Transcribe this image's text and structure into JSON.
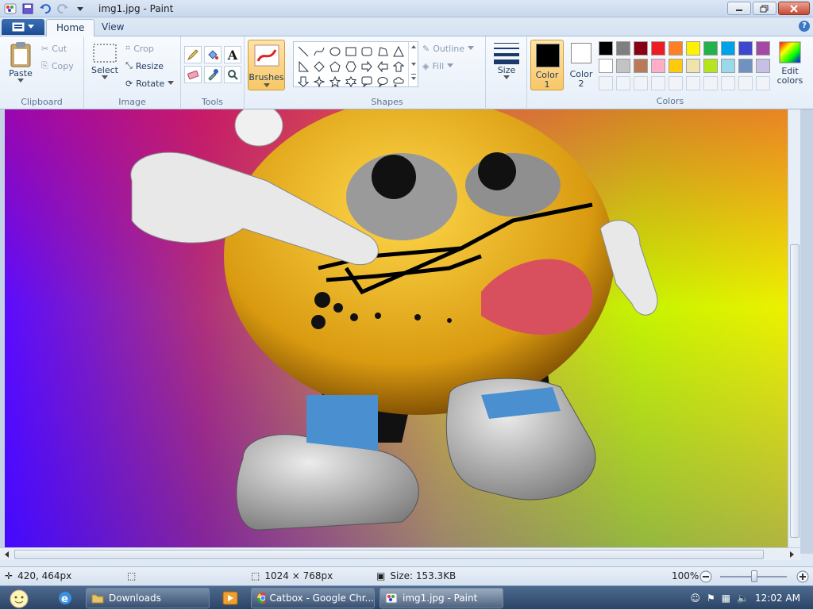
{
  "window": {
    "title": "img1.jpg - Paint"
  },
  "tabs": [
    {
      "label": "Home"
    },
    {
      "label": "View"
    }
  ],
  "clipboard": {
    "group": "Clipboard",
    "paste": "Paste",
    "cut": "Cut",
    "copy": "Copy"
  },
  "image": {
    "group": "Image",
    "select": "Select",
    "crop": "Crop",
    "resize": "Resize",
    "rotate": "Rotate"
  },
  "tools": {
    "group": "Tools"
  },
  "brushes": {
    "label": "Brushes"
  },
  "shapes": {
    "group": "Shapes",
    "outline": "Outline",
    "fill": "Fill"
  },
  "size": {
    "label": "Size"
  },
  "colors": {
    "group": "Colors",
    "color1_line1": "Color",
    "color1_line2": "1",
    "color2_line1": "Color",
    "color2_line2": "2",
    "edit_line1": "Edit",
    "edit_line2": "colors",
    "color1_value": "#000000",
    "color2_value": "#ffffff",
    "palette_row1": [
      "#000000",
      "#7f7f7f",
      "#880015",
      "#ed1c24",
      "#ff7f27",
      "#fff200",
      "#22b14c",
      "#00a2e8",
      "#3f48cc",
      "#a349a4"
    ],
    "palette_row2": [
      "#ffffff",
      "#c3c3c3",
      "#b97a57",
      "#ffaec9",
      "#ffc90e",
      "#efe4b0",
      "#b5e61d",
      "#99d9ea",
      "#7092be",
      "#c8bfe7"
    ]
  },
  "status": {
    "cursor_pos": "420, 464px",
    "image_size": "1024 × 768px",
    "file_size": "Size: 153.3KB",
    "zoom": "100%",
    "zoom_level": 1.0
  },
  "taskbar": {
    "items": [
      {
        "label": "Downloads"
      },
      {
        "label": "Catbox - Google Chr..."
      },
      {
        "label": "img1.jpg - Paint"
      }
    ],
    "clock": "12:02 AM"
  }
}
